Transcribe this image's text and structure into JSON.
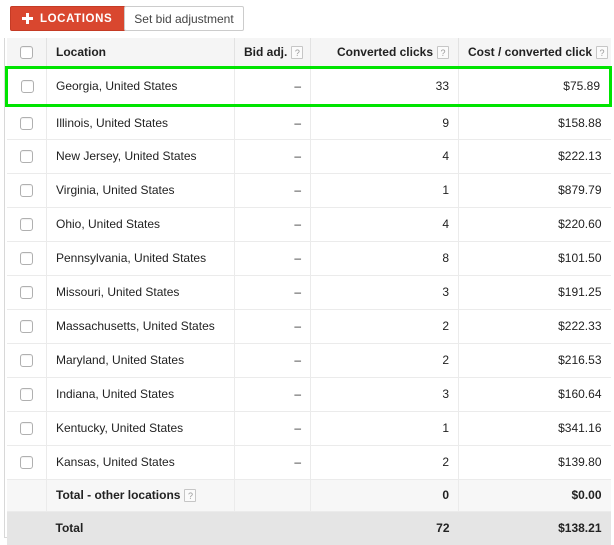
{
  "toolbar": {
    "add_locations_label": "LOCATIONS",
    "add_icon": "plus-icon",
    "set_bid_adjustment_label": "Set bid adjustment"
  },
  "colors": {
    "accent_red": "#D9472F",
    "highlight_green": "#00E400",
    "header_bg": "#F5F5F5",
    "total_bg": "#E5E5E5"
  },
  "table": {
    "columns": [
      {
        "key": "select",
        "label": "",
        "help": false
      },
      {
        "key": "location",
        "label": "Location",
        "help": false
      },
      {
        "key": "bid_adj",
        "label": "Bid adj.",
        "help": true,
        "help_glyph": "?"
      },
      {
        "key": "conv",
        "label": "Converted clicks",
        "help": true,
        "help_glyph": "?"
      },
      {
        "key": "cost",
        "label": "Cost / converted click",
        "help": true,
        "help_glyph": "?"
      }
    ],
    "rows": [
      {
        "location": "Georgia, United States",
        "bid_adj": "–",
        "converted_clicks": "33",
        "cost_per_converted_click": "$75.89",
        "highlighted": true
      },
      {
        "location": "Illinois, United States",
        "bid_adj": "–",
        "converted_clicks": "9",
        "cost_per_converted_click": "$158.88",
        "highlighted": false
      },
      {
        "location": "New Jersey, United States",
        "bid_adj": "–",
        "converted_clicks": "4",
        "cost_per_converted_click": "$222.13",
        "highlighted": false
      },
      {
        "location": "Virginia, United States",
        "bid_adj": "–",
        "converted_clicks": "1",
        "cost_per_converted_click": "$879.79",
        "highlighted": false
      },
      {
        "location": "Ohio, United States",
        "bid_adj": "–",
        "converted_clicks": "4",
        "cost_per_converted_click": "$220.60",
        "highlighted": false
      },
      {
        "location": "Pennsylvania, United States",
        "bid_adj": "–",
        "converted_clicks": "8",
        "cost_per_converted_click": "$101.50",
        "highlighted": false
      },
      {
        "location": "Missouri, United States",
        "bid_adj": "–",
        "converted_clicks": "3",
        "cost_per_converted_click": "$191.25",
        "highlighted": false
      },
      {
        "location": "Massachusetts, United States",
        "bid_adj": "–",
        "converted_clicks": "2",
        "cost_per_converted_click": "$222.33",
        "highlighted": false
      },
      {
        "location": "Maryland, United States",
        "bid_adj": "–",
        "converted_clicks": "2",
        "cost_per_converted_click": "$216.53",
        "highlighted": false
      },
      {
        "location": "Indiana, United States",
        "bid_adj": "–",
        "converted_clicks": "3",
        "cost_per_converted_click": "$160.64",
        "highlighted": false
      },
      {
        "location": "Kentucky, United States",
        "bid_adj": "–",
        "converted_clicks": "1",
        "cost_per_converted_click": "$341.16",
        "highlighted": false
      },
      {
        "location": "Kansas, United States",
        "bid_adj": "–",
        "converted_clicks": "2",
        "cost_per_converted_click": "$139.80",
        "highlighted": false
      }
    ],
    "subtotal": {
      "label": "Total - other locations",
      "help_glyph": "?",
      "bid_adj": "",
      "converted_clicks": "0",
      "cost_per_converted_click": "$0.00"
    },
    "total": {
      "label": "Total",
      "bid_adj": "",
      "converted_clicks": "72",
      "cost_per_converted_click": "$138.21"
    }
  }
}
